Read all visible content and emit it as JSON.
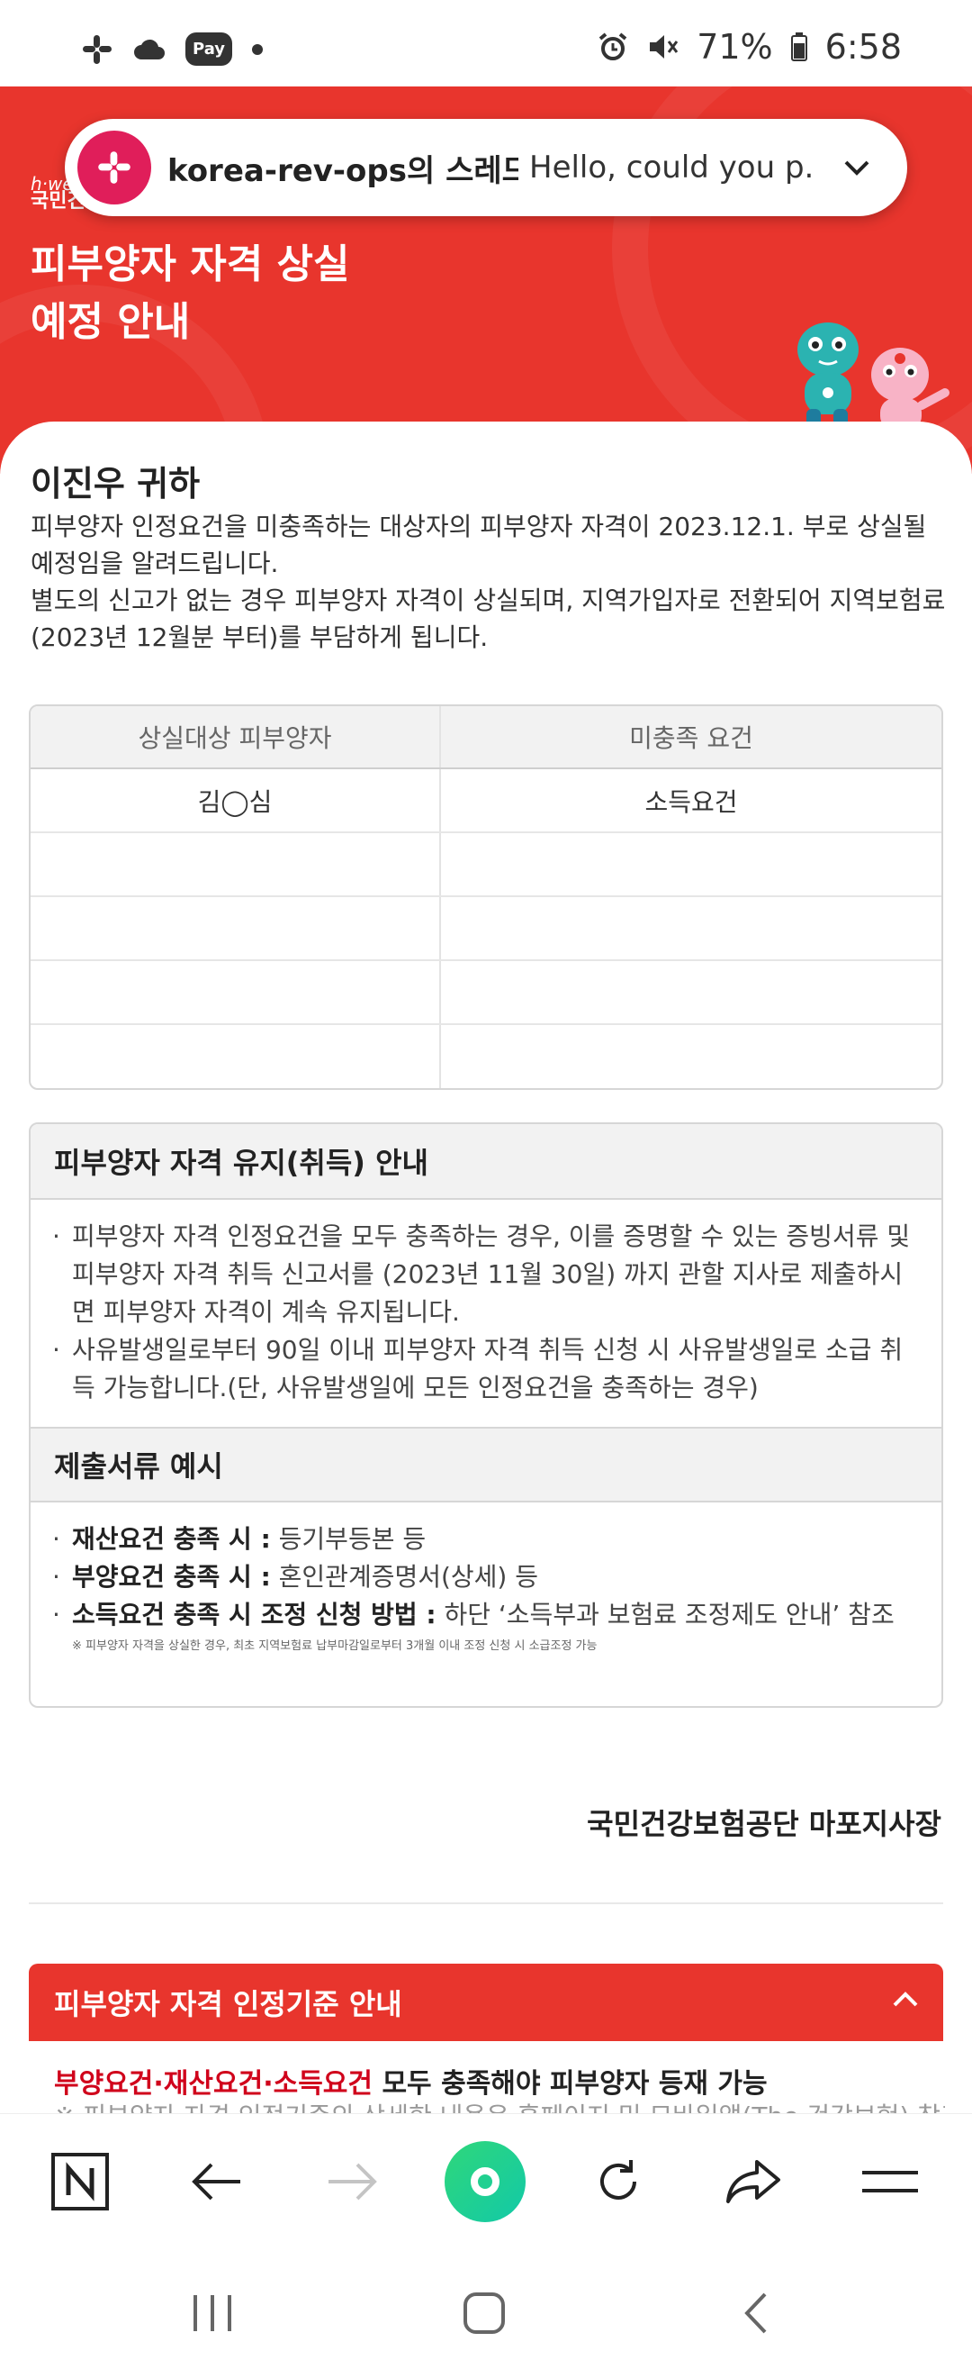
{
  "status_bar": {
    "battery": "71%",
    "time": "6:58",
    "pay_label": "Pay"
  },
  "notification": {
    "title": "korea-rev-ops의 스레드:...",
    "message": "Hello, could you p..."
  },
  "hero": {
    "logo_top": "h·well",
    "logo_bottom": "국민건",
    "title_line1": "피부양자 자격 상실",
    "title_line2": "예정 안내"
  },
  "letter": {
    "greeting": "이진우 귀하",
    "paragraph1": "피부양자 인정요건을 미충족하는 대상자의 피부양자 자격이 2023.12.1. 부로 상실될 예정임을 알려드립니다.",
    "paragraph2": "별도의 신고가 없는 경우 피부양자 자격이 상실되며, 지역가입자로 전환되어 지역보험료 (2023년 12월분 부터)를 부담하게 됩니다."
  },
  "table": {
    "headers": [
      "상실대상 피부양자",
      "미충족 요건"
    ],
    "rows": [
      [
        "김◯심",
        "소득요건"
      ],
      [
        "",
        ""
      ],
      [
        "",
        ""
      ],
      [
        "",
        ""
      ],
      [
        "",
        ""
      ]
    ]
  },
  "maintain": {
    "title": "피부양자 자격 유지(취득) 안내",
    "item1": "피부양자 자격 인정요건을 모두 충족하는 경우, 이를 증명할 수 있는 증빙서류 및 피부양자 자격 취득 신고서를 (2023년 11월 30일) 까지 관할 지사로 제출하시면 피부양자 자격이 계속 유지됩니다.",
    "item2": "사유발생일로부터 90일 이내 피부양자 자격 취득 신청 시 사유발생일로 소급 취득 가능합니다.(단, 사유발생일에 모든 인정요건을 충족하는 경우)"
  },
  "documents": {
    "title": "제출서류 예시",
    "items": [
      {
        "label": "재산요건 충족 시 :",
        "text": " 등기부등본 등"
      },
      {
        "label": "부양요건 충족 시 :",
        "text": " 혼인관계증명서(상세) 등"
      },
      {
        "label": "소득요건 충족 시 조정 신청 방법 :",
        "text": " 하단 ‘소득부과 보험료 조정제도 안내’ 참조"
      }
    ],
    "footnote": "※ 피부양자 자격을 상실한 경우, 최초 지역보험료 납부마감일로부터 3개월 이내 조정 신청 시 소급조정 가능"
  },
  "signature": "국민건강보험공단 마포지사장",
  "criteria": {
    "title": "피부양자 자격 인정기준 안내",
    "red_text": "부양요건·재산요건·소득요건",
    "black_text": " 모두 충족해야 피부양자 등재 가능",
    "partial_line": "※ 피부양자 자격 인정기준의 상세한 내용은 홈페이지 및 모바일앱(The 건강보험) 참조"
  },
  "colors": {
    "brand_red": "#e8352d",
    "emphasis_red": "#d0021b",
    "slack": "#e01e5a",
    "home_green": "#2fd77a"
  }
}
